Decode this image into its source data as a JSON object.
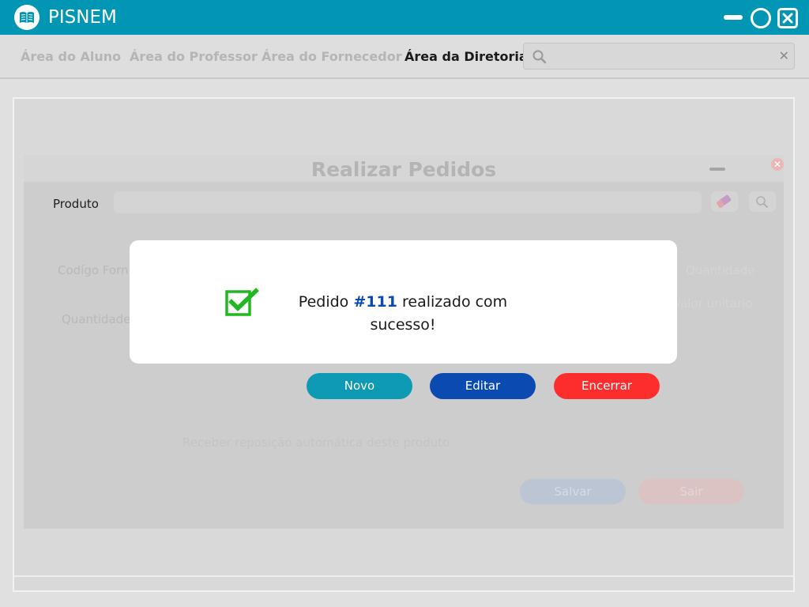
{
  "app": {
    "title": "PISNEM",
    "brand_color": "#0096b4"
  },
  "nav": {
    "items": [
      {
        "label": "Área do Aluno",
        "active": false
      },
      {
        "label": "Área do Professor",
        "active": false
      },
      {
        "label": "Área do Fornecedor",
        "active": false
      },
      {
        "label": "Área da Diretoria",
        "active": true
      }
    ],
    "search": {
      "value": "",
      "placeholder": ""
    }
  },
  "dialog": {
    "title": "Realizar Pedidos",
    "produto_label": "Produto",
    "codigo_label": "Codígo Forn",
    "quantidade_label": "Quantidade",
    "right_label_1": "Quantidade",
    "right_label_2": "Valor unitario",
    "repeat_text": "Receber reposição automática deste produto",
    "salvar_label": "Salvar",
    "sair_label": "Sair"
  },
  "actions": {
    "novo_label": "Novo",
    "editar_label": "Editar",
    "encerrar_label": "Encerrar",
    "colors": {
      "novo": "#0e9ab4",
      "editar": "#0b4ab0",
      "encerrar": "#fe2d2d"
    }
  },
  "modal": {
    "prefix": "Pedido",
    "order_number": "#111",
    "suffix": "realizado com sucesso!",
    "icon": "check-square-icon",
    "icon_color": "#1fb81f"
  }
}
